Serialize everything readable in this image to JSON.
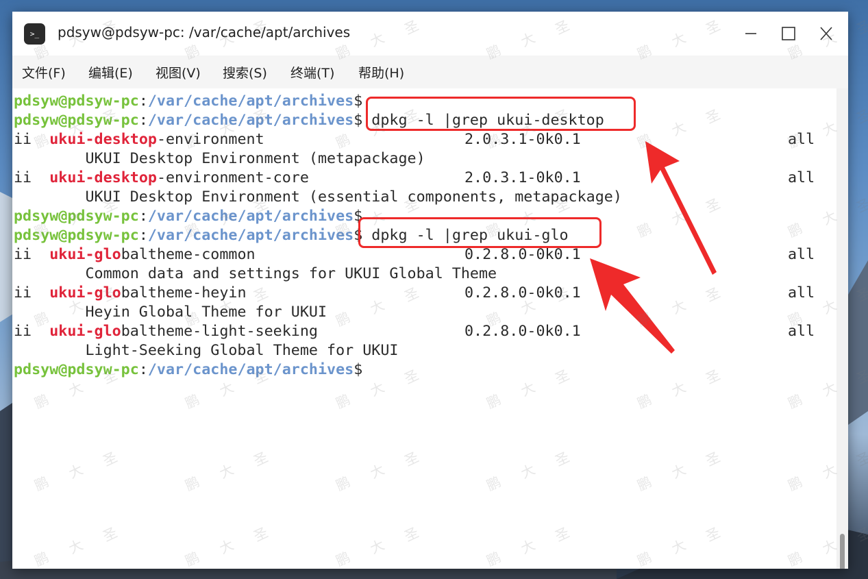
{
  "window": {
    "title": "pdsyw@pdsyw-pc: /var/cache/apt/archives",
    "app_icon_glyph": ">_",
    "minimize_icon": "minimize-icon",
    "maximize_icon": "maximize-icon",
    "close_icon": "close-icon"
  },
  "menu": [
    {
      "label": "文件(F)"
    },
    {
      "label": "编辑(E)"
    },
    {
      "label": "视图(V)"
    },
    {
      "label": "搜索(S)"
    },
    {
      "label": "终端(T)"
    },
    {
      "label": "帮助(H)"
    }
  ],
  "prompt": {
    "user": "pdsyw@pdsyw-pc",
    "colon": ":",
    "path": "/var/cache/apt/archives",
    "dollar": "$"
  },
  "commands": {
    "cmd1": " dpkg -l |grep ukui-desktop",
    "cmd2": " dpkg -l |grep ukui-glo"
  },
  "packages": [
    {
      "status": "ii",
      "match": "ukui-desktop",
      "rest": "-environment",
      "version": "2.0.3.1-0k0.1",
      "arch": "all",
      "description": "UKUI Desktop Environment (metapackage)"
    },
    {
      "status": "ii",
      "match": "ukui-desktop",
      "rest": "-environment-core",
      "version": "2.0.3.1-0k0.1",
      "arch": "all",
      "description": "UKUI Desktop Environment (essential components, metapackage)"
    },
    {
      "status": "ii",
      "match": "ukui-glo",
      "rest": "baltheme-common",
      "version": "0.2.8.0-0k0.1",
      "arch": "all",
      "description": "Common data and settings for UKUI Global Theme"
    },
    {
      "status": "ii",
      "match": "ukui-glo",
      "rest": "baltheme-heyin",
      "version": "0.2.8.0-0k0.1",
      "arch": "all",
      "description": "Heyin Global Theme for UKUI"
    },
    {
      "status": "ii",
      "match": "ukui-glo",
      "rest": "baltheme-light-seeking",
      "version": "0.2.8.0-0k0.1",
      "arch": "all",
      "description": "Light-Seeking Global Theme for UKUI"
    }
  ],
  "watermark": {
    "chars": [
      "鹏",
      "大",
      "圣"
    ]
  },
  "colors": {
    "prompt_user": "#77c23c",
    "prompt_path": "#6b94cc",
    "match_red": "#e0243a",
    "annotation_red": "#ee2a2a"
  }
}
